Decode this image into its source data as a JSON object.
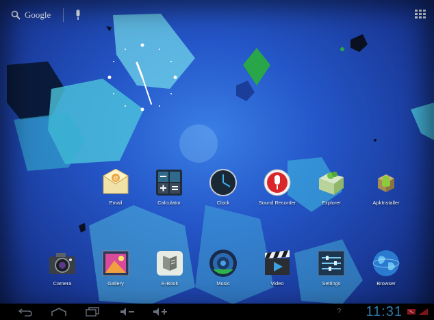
{
  "search": {
    "label": "Google"
  },
  "apps_row_1": [
    {
      "label": "Email",
      "icon": "email-icon"
    },
    {
      "label": "Calculator",
      "icon": "calculator-icon"
    },
    {
      "label": "Clock",
      "icon": "clock-icon"
    },
    {
      "label": "Sound Recorder",
      "icon": "microphone-icon"
    },
    {
      "label": "Explorer",
      "icon": "folder-icon"
    },
    {
      "label": "ApkInstaller",
      "icon": "android-package-icon"
    }
  ],
  "apps_row_2": [
    {
      "label": "Camera",
      "icon": "camera-icon"
    },
    {
      "label": "Gallery",
      "icon": "gallery-icon"
    },
    {
      "label": "E-Book",
      "icon": "book-icon"
    },
    {
      "label": "Music",
      "icon": "speaker-icon"
    },
    {
      "label": "Video",
      "icon": "clapperboard-icon"
    },
    {
      "label": "Settings",
      "icon": "sliders-icon"
    },
    {
      "label": "Browser",
      "icon": "globe-icon"
    }
  ],
  "status_bar": {
    "time": "11:31",
    "help_glyph": "?"
  },
  "colors": {
    "wallpaper_blue": "#2456c8",
    "clock_text": "#3aa7e6",
    "navbar": "#000000"
  }
}
